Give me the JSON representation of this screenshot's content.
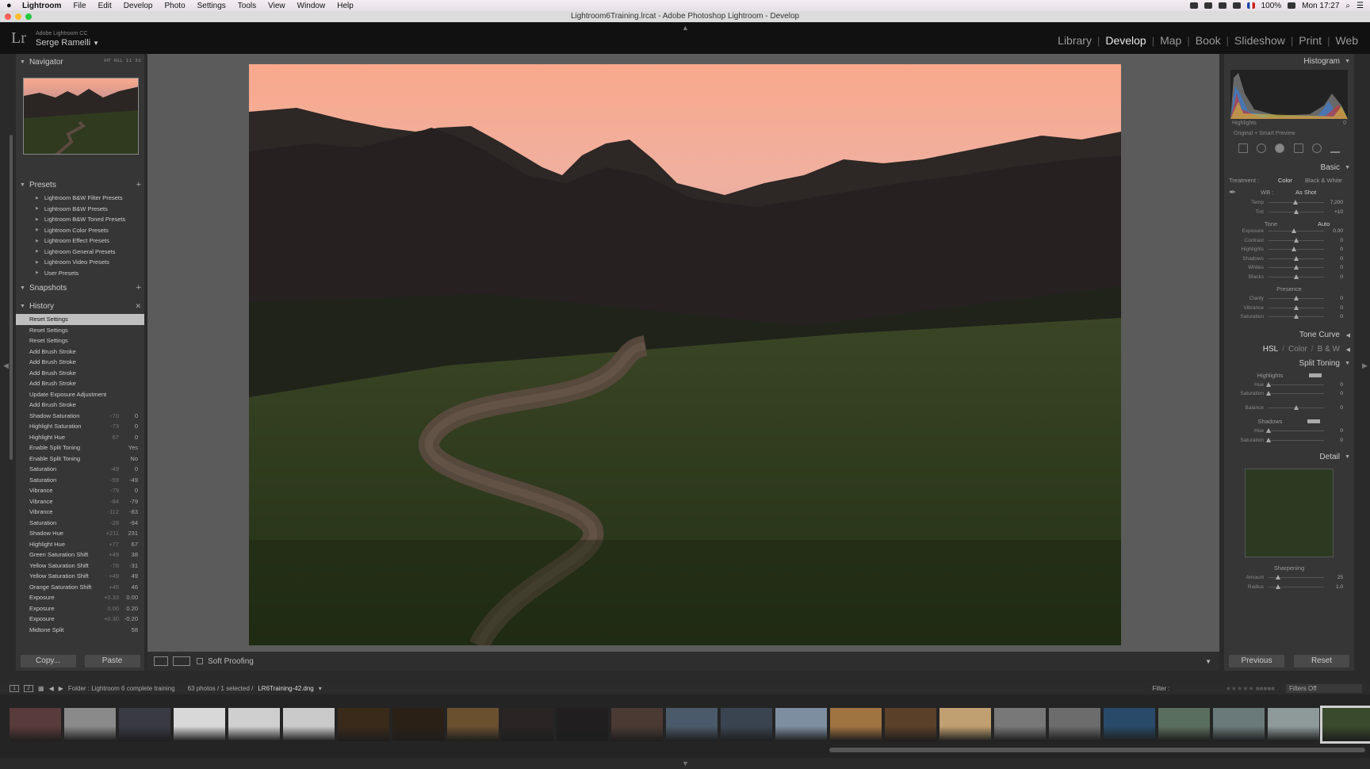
{
  "menubar": {
    "app": "Lightroom",
    "items": [
      "File",
      "Edit",
      "Develop",
      "Photo",
      "Settings",
      "Tools",
      "View",
      "Window",
      "Help"
    ],
    "battery": "100%",
    "clock": "Mon 17:27"
  },
  "window": {
    "title": "Lightroom6Training.lrcat - Adobe Photoshop Lightroom - Develop"
  },
  "identity": {
    "app_name": "Adobe Lightroom CC",
    "user": "Serge Ramelli"
  },
  "modules": [
    "Library",
    "Develop",
    "Map",
    "Book",
    "Slideshow",
    "Print",
    "Web"
  ],
  "left": {
    "navigator": {
      "title": "Navigator",
      "modes": [
        "FIT",
        "FILL",
        "1:1",
        "3:1"
      ]
    },
    "presets": {
      "title": "Presets",
      "items": [
        "Lightroom B&W Filter Presets",
        "Lightroom B&W Presets",
        "Lightroom B&W Toned Presets",
        "Lightroom Color Presets",
        "Lightroom Effect Presets",
        "Lightroom General Presets",
        "Lightroom Video Presets",
        "User Presets"
      ]
    },
    "snapshots": {
      "title": "Snapshots"
    },
    "history": {
      "title": "History",
      "items": [
        {
          "label": "Reset Settings",
          "before": "",
          "after": ""
        },
        {
          "label": "Reset Settings",
          "before": "",
          "after": ""
        },
        {
          "label": "Reset Settings",
          "before": "",
          "after": ""
        },
        {
          "label": "Add Brush Stroke",
          "before": "",
          "after": ""
        },
        {
          "label": "Add Brush Stroke",
          "before": "",
          "after": ""
        },
        {
          "label": "Add Brush Stroke",
          "before": "",
          "after": ""
        },
        {
          "label": "Add Brush Stroke",
          "before": "",
          "after": ""
        },
        {
          "label": "Update Exposure Adjustment",
          "before": "",
          "after": ""
        },
        {
          "label": "Add Brush Stroke",
          "before": "",
          "after": ""
        },
        {
          "label": "Shadow Saturation",
          "before": "-70",
          "after": "0"
        },
        {
          "label": "Highlight Saturation",
          "before": "-73",
          "after": "0"
        },
        {
          "label": "Highlight Hue",
          "before": "67",
          "after": "0"
        },
        {
          "label": "Enable Split Toning",
          "before": "",
          "after": "Yes"
        },
        {
          "label": "Enable Split Toning",
          "before": "",
          "after": "No"
        },
        {
          "label": "Saturation",
          "before": "-49",
          "after": "0"
        },
        {
          "label": "Saturation",
          "before": "-59",
          "after": "-49"
        },
        {
          "label": "Vibrance",
          "before": "-79",
          "after": "0"
        },
        {
          "label": "Vibrance",
          "before": "-84",
          "after": "-79"
        },
        {
          "label": "Vibrance",
          "before": "-112",
          "after": "-83"
        },
        {
          "label": "Saturation",
          "before": "-28",
          "after": "-94"
        },
        {
          "label": "Shadow Hue",
          "before": "+211",
          "after": "231"
        },
        {
          "label": "Highlight Hue",
          "before": "+77",
          "after": "67"
        },
        {
          "label": "Green Saturation Shift",
          "before": "+49",
          "after": "38"
        },
        {
          "label": "Yellow Saturation Shift",
          "before": "-78",
          "after": "-31"
        },
        {
          "label": "Yellow Saturation Shift",
          "before": "+49",
          "after": "49"
        },
        {
          "label": "Orange Saturation Shift",
          "before": "+45",
          "after": "46"
        },
        {
          "label": "Exposure",
          "before": "+0.33",
          "after": "0.00"
        },
        {
          "label": "Exposure",
          "before": "0.00",
          "after": "0.20"
        },
        {
          "label": "Exposure",
          "before": "+0.30",
          "after": "-0.20"
        },
        {
          "label": "Midtone Split",
          "before": "",
          "after": "58"
        }
      ]
    },
    "copy_label": "Copy...",
    "paste_label": "Paste"
  },
  "toolbar": {
    "soft_proofing": "Soft Proofing"
  },
  "right": {
    "histogram": {
      "title": "Histogram",
      "readout": "Highlights",
      "readout_value": "0",
      "preview_note": "Original + Smart Preview"
    },
    "basic": {
      "title": "Basic",
      "treatment_label": "Treatment :",
      "color": "Color",
      "bw": "Black & White",
      "wb_label": "WB :",
      "wb_value": "As Shot",
      "tone_label": "Tone",
      "auto": "Auto",
      "presence_label": "Presence",
      "sliders": [
        {
          "label": "Temp",
          "value": "7,200",
          "pos": 0.48
        },
        {
          "label": "Tint",
          "value": "+10",
          "pos": 0.5
        },
        {
          "label": "Exposure",
          "value": "0.00",
          "pos": 0.45
        },
        {
          "label": "Contrast",
          "value": "0",
          "pos": 0.5
        },
        {
          "label": "Highlights",
          "value": "0",
          "pos": 0.45
        },
        {
          "label": "Shadows",
          "value": "0",
          "pos": 0.5
        },
        {
          "label": "Whites",
          "value": "0",
          "pos": 0.5
        },
        {
          "label": "Blacks",
          "value": "0",
          "pos": 0.5
        },
        {
          "label": "Clarity",
          "value": "0",
          "pos": 0.5
        },
        {
          "label": "Vibrance",
          "value": "0",
          "pos": 0.5
        },
        {
          "label": "Saturation",
          "value": "0",
          "pos": 0.5
        }
      ]
    },
    "tone_curve": "Tone Curve",
    "hsl": [
      "HSL",
      "Color",
      "B & W"
    ],
    "split_toning": {
      "title": "Split Toning",
      "highlights": "Highlights",
      "shadows": "Shadows",
      "sliders": [
        {
          "label": "Hue",
          "value": "0",
          "pos": 0.0
        },
        {
          "label": "Saturation",
          "value": "0",
          "pos": 0.0
        },
        {
          "label": "Balance",
          "value": "0",
          "pos": 0.5
        },
        {
          "label": "Hue",
          "value": "0",
          "pos": 0.0
        },
        {
          "label": "Saturation",
          "value": "0",
          "pos": 0.0
        }
      ]
    },
    "detail": {
      "title": "Detail",
      "sharpening": "Sharpening",
      "sliders": [
        {
          "label": "Amount",
          "value": "25",
          "pos": 0.17
        },
        {
          "label": "Radius",
          "value": "1.0",
          "pos": 0.17
        }
      ]
    },
    "previous_label": "Previous",
    "reset_label": "Reset"
  },
  "filmstrip": {
    "folder": "Folder : Lightroom 6 complete training",
    "count": "63 photos / 1 selected /",
    "filename": "LR6Training-42.dng",
    "filter_label": "Filter :",
    "filters_off": "Filters Off",
    "thumb_colors": [
      "#5a3b3b",
      "#8a8a8a",
      "#3a3a44",
      "#d8d8d8",
      "#cfcfcf",
      "#cacaca",
      "#3a2a1a",
      "#2a2016",
      "#6b5030",
      "#2a2424",
      "#201e1e",
      "#4b3a34",
      "#4a5a6a",
      "#3a4450",
      "#7d8ea0",
      "#a07440",
      "#5a4028",
      "#c0a070",
      "#787878",
      "#6c6c6c",
      "#2a4a6a",
      "#5a6e5e",
      "#6a7a7a",
      "#8e9a9a",
      "#3a4a2c"
    ]
  },
  "colors": {
    "accent": "#e8e8e8",
    "panel": "#363636",
    "sky_top": "#f8a98c",
    "sky_bottom": "#b98b92",
    "grass": "#2e3b1c"
  }
}
